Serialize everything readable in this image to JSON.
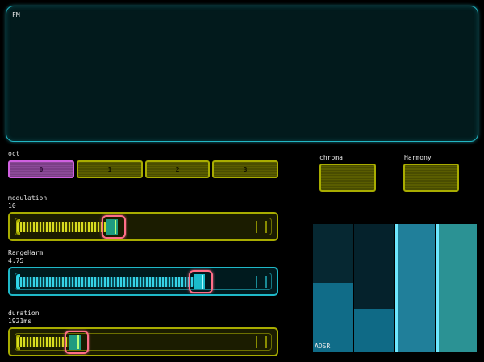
{
  "fm": {
    "label": "FM"
  },
  "oct": {
    "label": "oct",
    "selected": "0",
    "buttons": [
      "0",
      "1",
      "2",
      "3"
    ],
    "colors": {
      "selected": "#d060e0",
      "unselected": "#a8ac00"
    }
  },
  "chroma": {
    "label": "chroma"
  },
  "harmony": {
    "label": "Harmony"
  },
  "sliders": {
    "modulation": {
      "label": "modulation",
      "value": "10",
      "fraction": 0.38,
      "color": "#a8ac00"
    },
    "rangeharm": {
      "label": "RangeHarm",
      "value": "4.75",
      "fraction": 0.75,
      "color": "#1fb8c8"
    },
    "duration": {
      "label": "duration",
      "value": "1921ms",
      "fraction": 0.22,
      "color": "#a8ac00"
    }
  },
  "adsr": {
    "label": "ADSR",
    "levels": [
      0.54,
      0.34,
      1.0,
      1.0
    ]
  },
  "icons": {
    "slider-end": "double-chevron-right-icon"
  }
}
